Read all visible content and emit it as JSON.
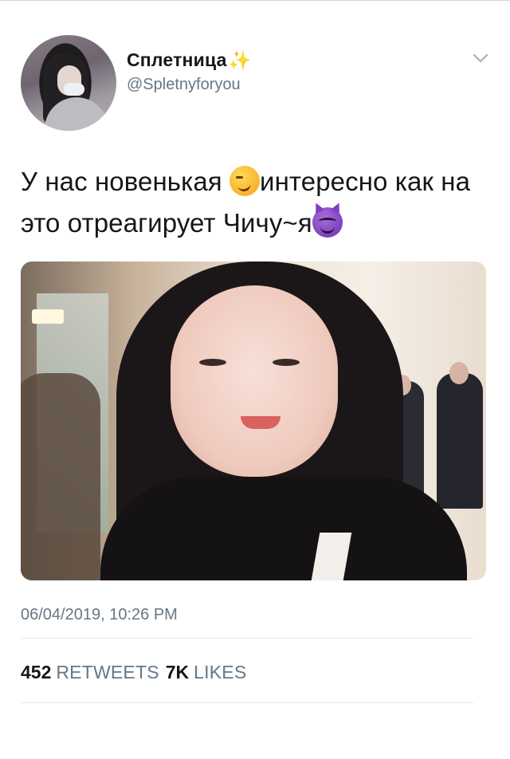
{
  "tweet": {
    "display_name": "Сплетница",
    "name_emoji": "✨",
    "handle": "@Spletnyforyou",
    "text_part1": "У нас новенькая ",
    "text_part2": "интересно как на это отреагирует Чичу~я",
    "emoji_1": "smirking-face",
    "emoji_2": "smiling-face-with-horns",
    "timestamp": "06/04/2019, 10:26 PM",
    "retweets_count": "452",
    "retweets_label": "RETWEETS",
    "likes_count": "7K",
    "likes_label": "LIKES"
  },
  "icons": {
    "menu": "chevron-down-icon"
  },
  "colors": {
    "text": "#14171a",
    "secondary": "#657786",
    "divider": "#e1e8ed"
  }
}
